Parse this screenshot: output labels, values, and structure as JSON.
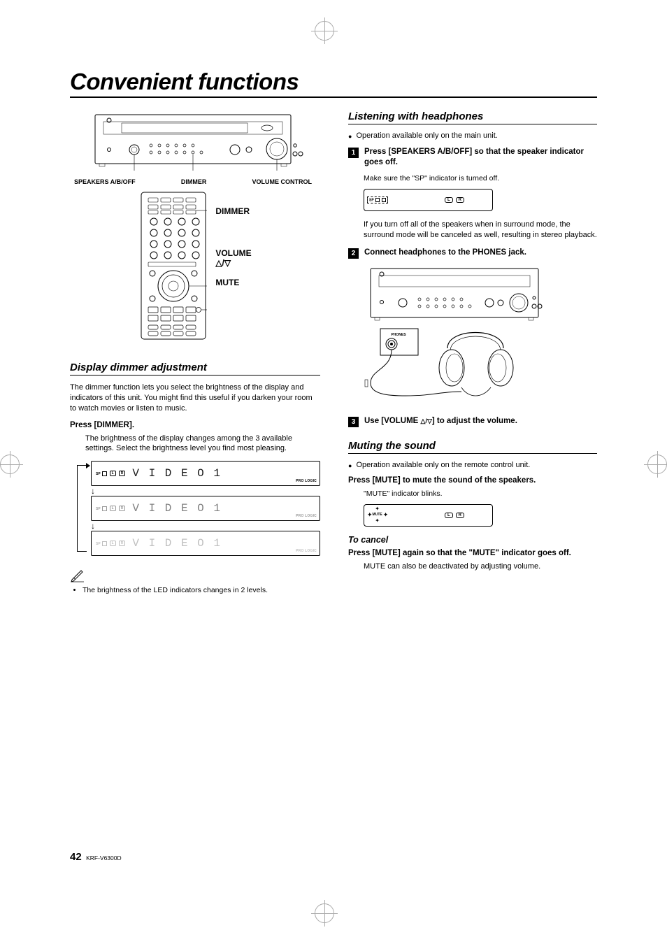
{
  "page": {
    "chapter_title": "Convenient functions",
    "footer_model": "KRF-V6300D",
    "footer_page": "42"
  },
  "receiver_labels": {
    "speakers": "SPEAKERS A/B/OFF",
    "dimmer": "DIMMER",
    "volume_ctrl": "VOLUME CONTROL"
  },
  "remote_labels": {
    "dimmer": "DIMMER",
    "volume": "VOLUME",
    "updown": "△/▽",
    "mute": "MUTE"
  },
  "dimmer_section": {
    "title": "Display dimmer adjustment",
    "intro": "The dimmer function lets you select the brightness of the display and indicators of this unit. You might find this useful if you darken your room to watch movies or listen to music.",
    "instruction": "Press [DIMMER].",
    "press_body": "The brightness of the display changes among the 3 available settings. Select the brightness level you find most pleasing.",
    "note_bullet": "The brightness of the LED indicators changes in 2 levels.",
    "prologic_label": "PRO LOGIC",
    "seg_text": "V I D E O 1",
    "lr_L": "L",
    "lr_R": "R",
    "sp_label": "SP",
    "box_A": "A"
  },
  "headphones_section": {
    "title": "Listening with headphones",
    "avail_main": "Operation available only on the main unit.",
    "step1": "Press [SPEAKERS A/B/OFF] so that the speaker indicator goes off.",
    "step1_note": "Make sure the \"SP\" indicator is turned off.",
    "step1_surround": "If you turn off all of the speakers when in surround mode, the surround mode will be canceled as well, resulting in stereo playback.",
    "step2": "Connect headphones to the PHONES jack.",
    "step3_pre": "Use [VOLUME ",
    "step3_tri": "△/▽",
    "step3_post": "] to adjust the volume.",
    "phones_label": "PHONES",
    "lr_L": "L",
    "lr_R": "R",
    "sp_label": "SP",
    "box_A": "A",
    "box_B": "B"
  },
  "mute_section": {
    "title": "Muting the sound",
    "avail_remote": "Operation available only on the remote control unit.",
    "instruction": "Press [MUTE] to mute the sound of the speakers.",
    "mute_blinks": "\"MUTE\" indicator blinks.",
    "mute_label": "MUTE",
    "cancel_title": "To cancel",
    "cancel_instruction": "Press [MUTE] again so that the \"MUTE\" indicator goes off.",
    "cancel_body": "MUTE can also be deactivated by adjusting volume.",
    "lr_L": "L",
    "lr_R": "R"
  }
}
